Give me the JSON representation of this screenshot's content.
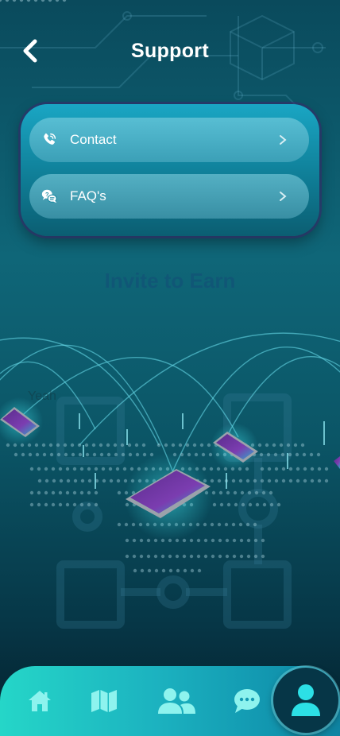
{
  "header": {
    "title": "Support"
  },
  "menu": [
    {
      "label": "Contact",
      "icon": "phone-icon"
    },
    {
      "label": "FAQ's",
      "icon": "faq-chat-icon"
    }
  ],
  "background_text": {
    "invite": "Invite to Earn",
    "yeah": "Yeah"
  },
  "tabbar": {
    "tabs": [
      {
        "icon": "home-icon"
      },
      {
        "icon": "map-icon"
      },
      {
        "icon": "users-icon"
      },
      {
        "icon": "chat-icon"
      },
      {
        "icon": "profile-icon",
        "active": true
      }
    ]
  },
  "colors": {
    "accent": "#25d6c8",
    "icon": "#8ef3ee",
    "active_bg": "#063647"
  }
}
